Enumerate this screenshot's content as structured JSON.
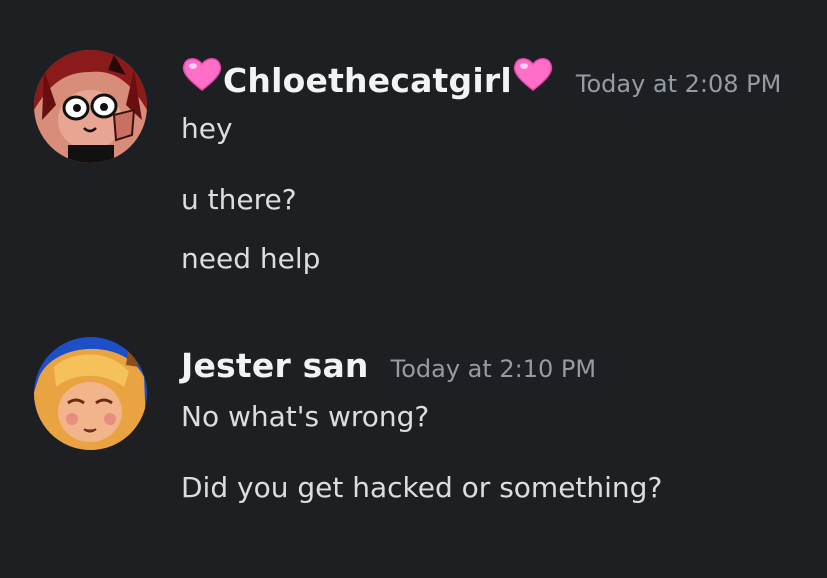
{
  "messages": [
    {
      "author": "Chloethecatgirl",
      "author_decoration": "pink-heart-icon",
      "timestamp": "Today at 2:08 PM",
      "lines": [
        "hey",
        "u there?",
        "need help"
      ]
    },
    {
      "author": "Jester san",
      "timestamp": "Today at 2:10 PM",
      "lines": [
        "No what's wrong?",
        "Did you get hacked or something?"
      ]
    }
  ],
  "colors": {
    "background": "#1e1f22",
    "username": "#f2f3f5",
    "timestamp": "#949ba4",
    "text": "#dbdee1",
    "heart": "#ff6fc8"
  }
}
